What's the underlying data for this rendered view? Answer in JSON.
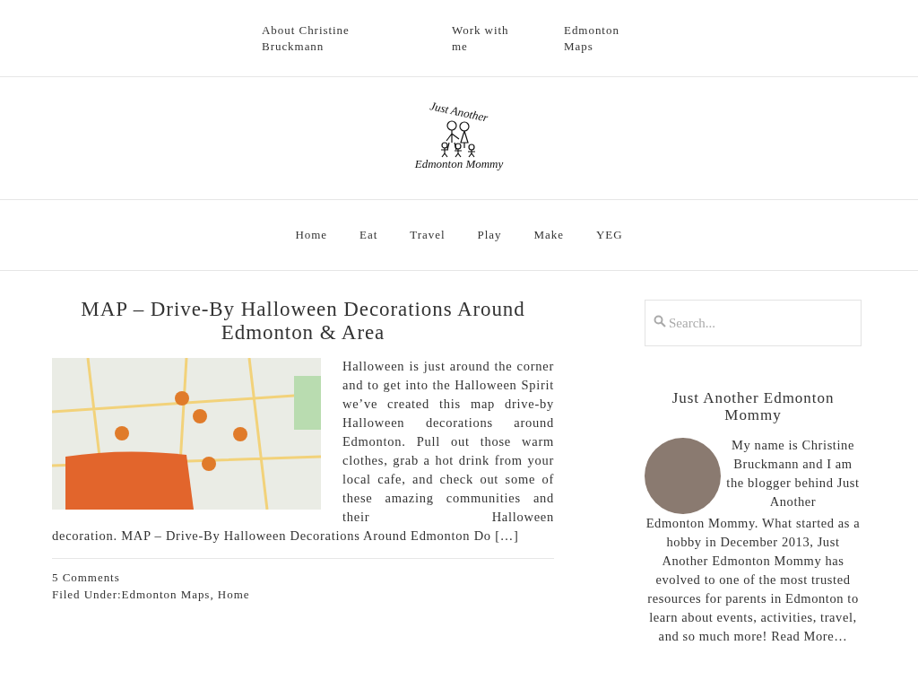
{
  "top_nav": {
    "items": [
      {
        "label": "About Christine Bruckmann"
      },
      {
        "label": "Work with me"
      },
      {
        "label": "Edmonton Maps"
      }
    ]
  },
  "logo": {
    "line_1": "Just Another",
    "line_2": "Edmonton Mommy"
  },
  "main_nav": {
    "items": [
      {
        "label": "Home"
      },
      {
        "label": "Eat"
      },
      {
        "label": "Travel"
      },
      {
        "label": "Play"
      },
      {
        "label": "Make"
      },
      {
        "label": "YEG"
      }
    ]
  },
  "post": {
    "title": "MAP – Drive-By Halloween Decorations Around Edmonton & Area",
    "excerpt_beside_image": "Halloween is just around the corner and to get into the Halloween Spirit we’ve created this map drive-by Halloween decorations around Edmonton. Pull out those warm clothes, grab a hot drink from your local cafe, and check out some of these amazing communities and their Halloween",
    "excerpt_below_image": "decoration. MAP – Drive-By Halloween Decorations Around Edmonton Do […]",
    "comments": "5 Comments",
    "filed_under_label": "Filed Under:",
    "categories": [
      "Edmonton Maps",
      "Home"
    ],
    "category_separator": ","
  },
  "sidebar": {
    "search": {
      "placeholder": "Search..."
    },
    "widget_title": "Just Another Edmonton Mommy",
    "bio_beside_photo": "My name is Christine Bruckmann and I am the blogger behind Just Another",
    "bio_below_photo": "Edmonton Mommy. What started as a hobby in December 2013, Just Another Edmonton Mommy has evolved to one of the most trusted resources for parents in Edmonton to learn about events, activities, travel, and so much more!",
    "read_more": "Read More…"
  }
}
